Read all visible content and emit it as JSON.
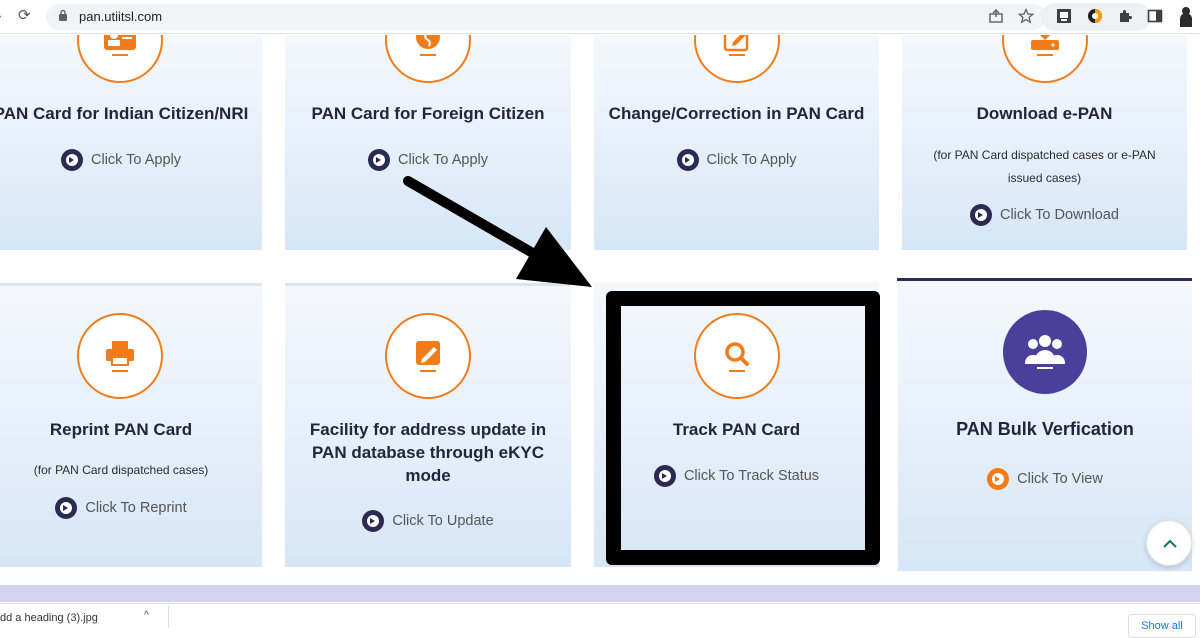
{
  "browser": {
    "url": "pan.utiitsl.com"
  },
  "cards": {
    "indian": {
      "title": "PAN Card for Indian Citizen/NRI",
      "action": "Click To Apply"
    },
    "foreign": {
      "title": "PAN Card for Foreign Citizen",
      "action": "Click To Apply"
    },
    "change": {
      "title": "Change/Correction in PAN Card",
      "action": "Click To Apply"
    },
    "epan": {
      "title": "Download e-PAN",
      "note_line1": "(for PAN Card dispatched cases or e-PAN",
      "note_line2": "issued cases)",
      "action": "Click To Download"
    },
    "reprint": {
      "title": "Reprint PAN Card",
      "note": "(for PAN Card dispatched cases)",
      "action": "Click To Reprint"
    },
    "address": {
      "title_line1": "Facility for address update in",
      "title_line2": "PAN database through eKYC",
      "title_line3": "mode",
      "action": "Click To Update"
    },
    "track": {
      "title": "Track PAN Card",
      "action": "Click To Track Status"
    },
    "bulk": {
      "title": "PAN Bulk Verfication",
      "action": "Click To View"
    }
  },
  "download_shelf": {
    "item": "dd a heading (3).jpg",
    "show_all": "Show all"
  },
  "colors": {
    "accent_orange": "#f07c1b",
    "navy": "#2c2a52",
    "bulk_purple": "#4a3f9a",
    "annotation": "#000000"
  },
  "icons": [
    "reload-icon",
    "lock-icon",
    "share-icon",
    "star-icon",
    "extension-icon",
    "puzzle-icon",
    "sidebar-icon",
    "profile-icon",
    "id-card-icon",
    "globe-icon",
    "edit-document-icon",
    "download-icon",
    "printer-icon",
    "pencil-icon",
    "search-icon",
    "users-icon",
    "chevron-up-icon",
    "arrow-annotation-icon"
  ]
}
